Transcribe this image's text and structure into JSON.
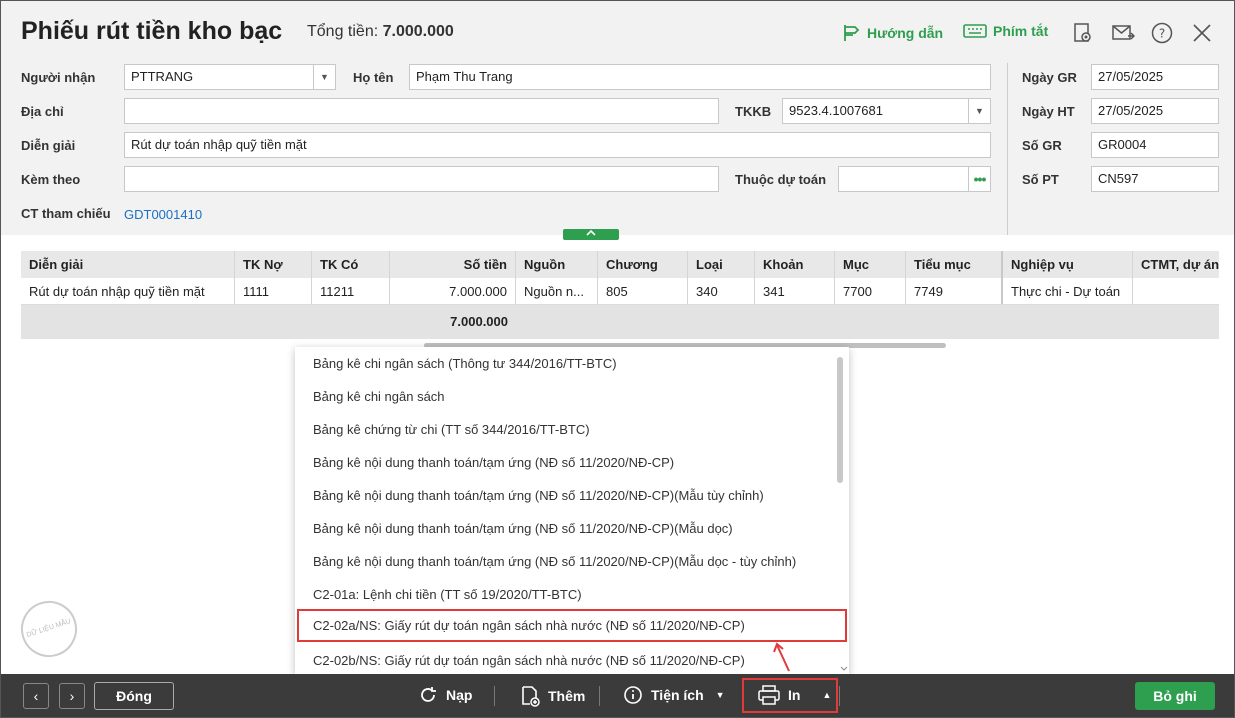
{
  "header": {
    "title": "Phiếu rút tiền kho bạc",
    "total_label": "Tổng tiền:",
    "total_value": "7.000.000",
    "guide_label": "Hướng dẫn",
    "shortcut_label": "Phím tắt",
    "accent_color": "#2e9e4f"
  },
  "form": {
    "nguoi_nhan_label": "Người nhận",
    "nguoi_nhan_value": "PTTRANG",
    "ho_ten_label": "Họ tên",
    "ho_ten_value": "Phạm Thu Trang",
    "dia_chi_label": "Địa chỉ",
    "dia_chi_value": "",
    "tkkb_label": "TKKB",
    "tkkb_value": "9523.4.1007681",
    "dien_giai_label": "Diễn giải",
    "dien_giai_value": "Rút dự toán nhập quỹ tiền mặt",
    "kem_theo_label": "Kèm theo",
    "kem_theo_value": "",
    "thuoc_du_toan_label": "Thuộc dự toán",
    "thuoc_du_toan_value": "",
    "ct_tham_chieu_label": "CT tham chiếu",
    "ct_tham_chieu_value": "GDT0001410",
    "ngay_gr_label": "Ngày GR",
    "ngay_gr_value": "27/05/2025",
    "ngay_ht_label": "Ngày HT",
    "ngay_ht_value": "27/05/2025",
    "so_gr_label": "Số GR",
    "so_gr_value": "GR0004",
    "so_pt_label": "Số PT",
    "so_pt_value": "CN597"
  },
  "grid": {
    "columns": [
      "Diễn giải",
      "TK Nợ",
      "TK Có",
      "Số tiền",
      "Nguồn",
      "Chương",
      "Loại",
      "Khoản",
      "Mục",
      "Tiểu mục",
      "Nghiệp vụ",
      "CTMT, dự án"
    ],
    "row": [
      "Rút dự toán nhập quỹ tiền mặt",
      "1111",
      "11211",
      "7.000.000",
      "Nguồn n...",
      "805",
      "340",
      "341",
      "7700",
      "7749",
      "Thực chi - Dự toán",
      ""
    ],
    "total": "7.000.000"
  },
  "print_menu": {
    "items": [
      "Bảng kê chi ngân sách (Thông tư 344/2016/TT-BTC)",
      "Bảng kê chi ngân sách",
      "Bảng kê chứng từ chi (TT số 344/2016/TT-BTC)",
      "Bảng kê nội dung thanh toán/tạm ứng (NĐ số 11/2020/NĐ-CP)",
      "Bảng kê nội dung thanh toán/tạm ứng (NĐ số 11/2020/NĐ-CP)(Mẫu tùy chỉnh)",
      "Bảng kê nội dung thanh toán/tạm ứng (NĐ số 11/2020/NĐ-CP)(Mẫu dọc)",
      "Bảng kê nội dung thanh toán/tạm ứng (NĐ số 11/2020/NĐ-CP)(Mẫu dọc - tùy chỉnh)",
      "C2-01a: Lệnh chi tiền (TT số 19/2020/TT-BTC)",
      "C2-02a/NS: Giấy rút dự toán ngân sách nhà nước (NĐ số 11/2020/NĐ-CP)",
      "C2-02b/NS: Giấy rút dự toán ngân sách nhà nước (NĐ số 11/2020/NĐ-CP)"
    ],
    "highlighted_index": 8,
    "highlight_color": "#e03a3a"
  },
  "footer": {
    "close_label": "Đóng",
    "reload_label": "Nạp",
    "add_label": "Thêm",
    "utility_label": "Tiện ích",
    "print_label": "In",
    "save_label": "Bỏ ghi"
  },
  "watermark": "DỮ LIỆU MẪU"
}
